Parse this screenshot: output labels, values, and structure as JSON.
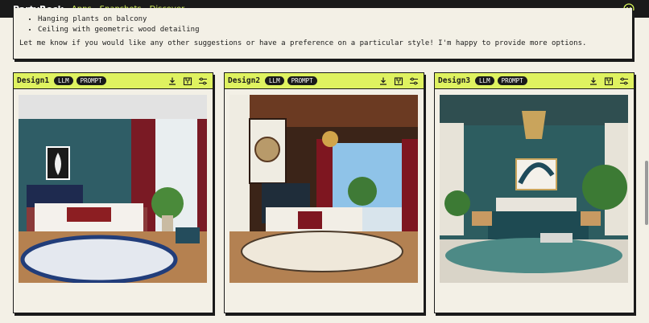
{
  "app": {
    "brand": "PartyRock"
  },
  "nav": {
    "items": [
      "Apps",
      "Snapshots",
      "Discover"
    ]
  },
  "chat": {
    "bullets": [
      "Hanging plants on balcony",
      "Ceiling with geometric wood detailing"
    ],
    "closing": "Let me know if you would like any other suggestions or have a preference on a particular style! I'm happy to provide more options."
  },
  "designs": [
    {
      "title": "Design1",
      "tags": [
        "LLM",
        "PROMPT"
      ],
      "image_alt": "Bedroom with teal walls, red curtains and blue patterned rug"
    },
    {
      "title": "Design2",
      "tags": [
        "LLM",
        "PROMPT"
      ],
      "image_alt": "Bedroom with wood ceiling, chandelier and balcony view"
    },
    {
      "title": "Design3",
      "tags": [
        "LLM",
        "PROMPT"
      ],
      "image_alt": "Bedroom with teal walls, gold pendant and green bedding"
    }
  ],
  "colors": {
    "accent": "#dff260",
    "dark": "#1a1a1a",
    "background": "#f3f0e6",
    "nav_link": "#d6f55a"
  },
  "icons": [
    "user-face-icon",
    "download-icon",
    "save-icon",
    "settings-sliders-icon"
  ]
}
